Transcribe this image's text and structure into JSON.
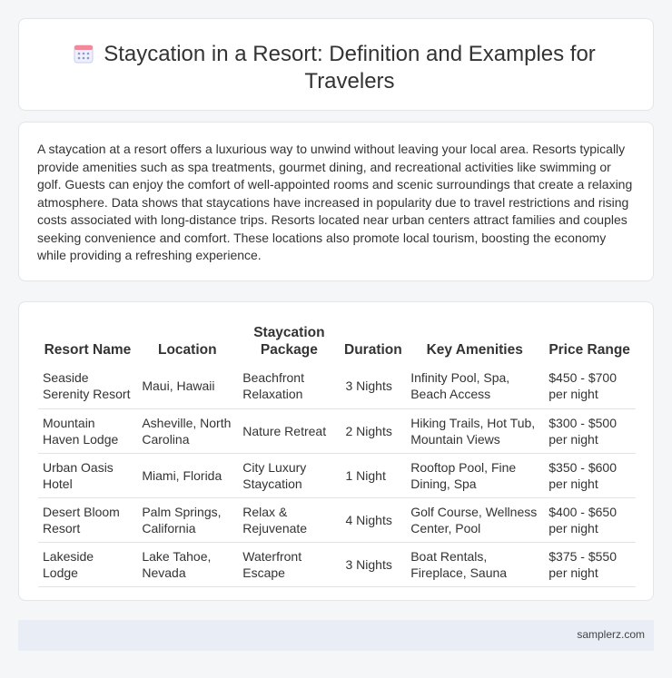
{
  "header": {
    "title": "Staycation in a Resort: Definition and Examples for Travelers",
    "icon": "calendar-icon"
  },
  "intro": {
    "text": "A staycation at a resort offers a luxurious way to unwind without leaving your local area. Resorts typically provide amenities such as spa treatments, gourmet dining, and recreational activities like swimming or golf. Guests can enjoy the comfort of well-appointed rooms and scenic surroundings that create a relaxing atmosphere. Data shows that staycations have increased in popularity due to travel restrictions and rising costs associated with long-distance trips. Resorts located near urban centers attract families and couples seeking convenience and comfort. These locations also promote local tourism, boosting the economy while providing a refreshing experience."
  },
  "table": {
    "headers": [
      "Resort Name",
      "Location",
      "Staycation Package",
      "Duration",
      "Key Amenities",
      "Price Range"
    ],
    "rows": [
      [
        "Seaside Serenity Resort",
        "Maui, Hawaii",
        "Beachfront Relaxation",
        "3 Nights",
        "Infinity Pool, Spa, Beach Access",
        "$450 - $700 per night"
      ],
      [
        "Mountain Haven Lodge",
        "Asheville, North Carolina",
        "Nature Retreat",
        "2 Nights",
        "Hiking Trails, Hot Tub, Mountain Views",
        "$300 - $500 per night"
      ],
      [
        "Urban Oasis Hotel",
        "Miami, Florida",
        "City Luxury Staycation",
        "1 Night",
        "Rooftop Pool, Fine Dining, Spa",
        "$350 - $600 per night"
      ],
      [
        "Desert Bloom Resort",
        "Palm Springs, California",
        "Relax & Rejuvenate",
        "4 Nights",
        "Golf Course, Wellness Center, Pool",
        "$400 - $650 per night"
      ],
      [
        "Lakeside Lodge",
        "Lake Tahoe, Nevada",
        "Waterfront Escape",
        "3 Nights",
        "Boat Rentals, Fireplace, Sauna",
        "$375 - $550 per night"
      ]
    ]
  },
  "footer": {
    "text": "samplerz.com"
  }
}
